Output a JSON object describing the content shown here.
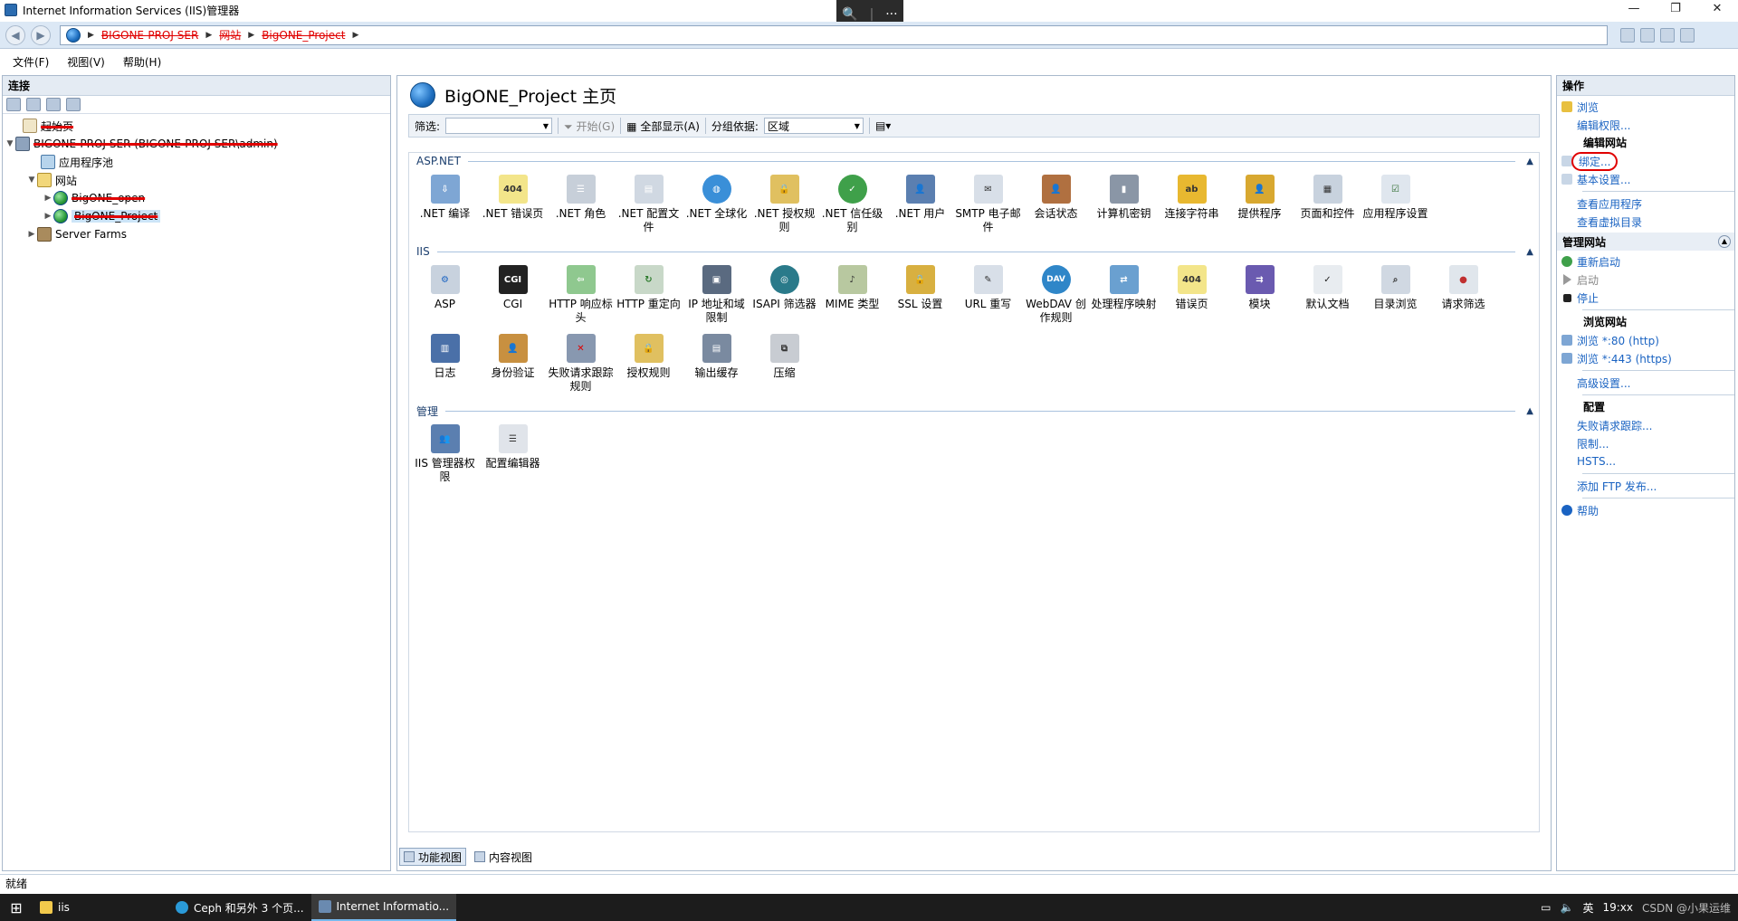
{
  "window": {
    "title": "Internet Information Services (IIS)管理器",
    "controls": [
      "—",
      "❐",
      "✕"
    ]
  },
  "zoombar": {
    "zoom_icon": "🔍",
    "more": "···"
  },
  "address": {
    "crumbs": [
      {
        "text": "BIGONE-PROJ-SER"
      },
      {
        "text": "网站"
      },
      {
        "text": "BigONE_Project"
      }
    ]
  },
  "menu": {
    "items": [
      "文件(F)",
      "视图(V)",
      "帮助(H)"
    ]
  },
  "connections": {
    "title": "连接",
    "tree": {
      "start_page": "起始页",
      "server": "BIGONE-PROJ-SER (BIGONE-PROJ-SER\\admin)",
      "app_pools": "应用程序池",
      "sites": "网站",
      "site1": "BigONE_open",
      "site2": "BigONE_Project",
      "server_farms": "Server Farms"
    }
  },
  "main": {
    "page_title": "BigONE_Project 主页",
    "filter": {
      "label": "筛选:",
      "start": "开始(G)",
      "show_all": "全部显示(A)",
      "group_label": "分组依据:",
      "group_value": "区域"
    },
    "groups": {
      "aspnet": {
        "title": "ASP.NET",
        "items": [
          ".NET 编译",
          ".NET 错误页",
          ".NET 角色",
          ".NET 配置文件",
          ".NET 全球化",
          ".NET 授权规则",
          ".NET 信任级别",
          ".NET 用户",
          "SMTP 电子邮件",
          "会话状态",
          "计算机密钥",
          "连接字符串",
          "提供程序",
          "页面和控件",
          "应用程序设置"
        ]
      },
      "iis": {
        "title": "IIS",
        "items": [
          "ASP",
          "CGI",
          "HTTP 响应标头",
          "HTTP 重定向",
          "IP 地址和域限制",
          "ISAPI 筛选器",
          "MIME 类型",
          "SSL 设置",
          "URL 重写",
          "WebDAV 创作规则",
          "处理程序映射",
          "错误页",
          "模块",
          "默认文档",
          "目录浏览",
          "请求筛选",
          "日志",
          "身份验证",
          "失败请求跟踪规则",
          "授权规则",
          "输出缓存",
          "压缩"
        ]
      },
      "mgmt": {
        "title": "管理",
        "items": [
          "IIS 管理器权限",
          "配置编辑器"
        ]
      }
    },
    "icon_text": {
      "cgi": "CGI",
      "err": "404",
      "dav": "DAV"
    },
    "tabs": {
      "features": "功能视图",
      "content": "内容视图"
    }
  },
  "actions": {
    "title": "操作",
    "browse": "浏览",
    "edit_perms": "编辑权限...",
    "edit_site": "编辑网站",
    "bindings": "绑定...",
    "basic_settings": "基本设置...",
    "view_apps": "查看应用程序",
    "view_vdirs": "查看虚拟目录",
    "manage_site": "管理网站",
    "restart": "重新启动",
    "start": "启动",
    "stop": "停止",
    "browse_site": "浏览网站",
    "browse_80": "浏览 *:80 (http)",
    "browse_443": "浏览 *:443 (https)",
    "advanced": "高级设置...",
    "config": "配置",
    "failed_req": "失败请求跟踪...",
    "limits": "限制...",
    "hsts": "HSTS...",
    "add_ftp": "添加 FTP 发布...",
    "help": "帮助"
  },
  "status": {
    "text": "就绪"
  },
  "taskbar": {
    "items": [
      {
        "label": "iis"
      },
      {
        "label": "Ceph 和另外 3 个页..."
      },
      {
        "label": "Internet Informatio..."
      }
    ],
    "tray_text": "CSDN @小果运维",
    "ime": "英",
    "clock": "19:xx"
  },
  "colors": {
    "accent": "#1a63c2",
    "annotation": "#e00000",
    "pane_border": "#a9b9cc"
  }
}
